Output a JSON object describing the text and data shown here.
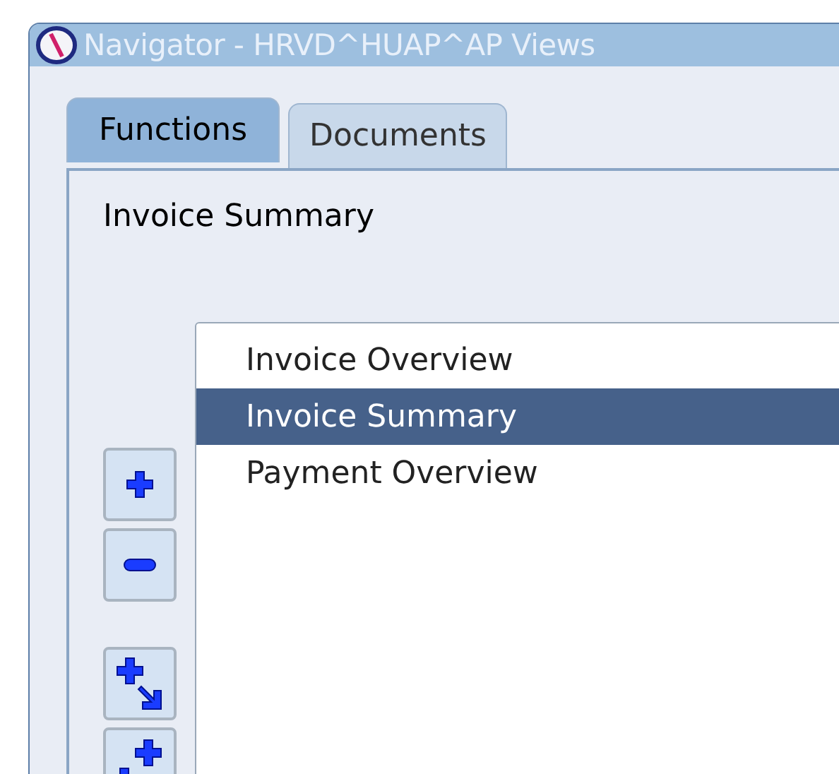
{
  "window": {
    "title": "Navigator - HRVD^HUAP^AP Views"
  },
  "tabs": [
    {
      "label": "Functions",
      "selected": true
    },
    {
      "label": "Documents",
      "selected": false
    }
  ],
  "current_function": "Invoice Summary",
  "list": [
    {
      "label": "Invoice Overview",
      "selected": false
    },
    {
      "label": "Invoice Summary",
      "selected": true
    },
    {
      "label": "Payment Overview",
      "selected": false
    }
  ],
  "side_buttons": [
    {
      "kind": "expand"
    },
    {
      "kind": "collapse"
    },
    {
      "kind": "expand-branch"
    },
    {
      "kind": "expand-all"
    }
  ]
}
